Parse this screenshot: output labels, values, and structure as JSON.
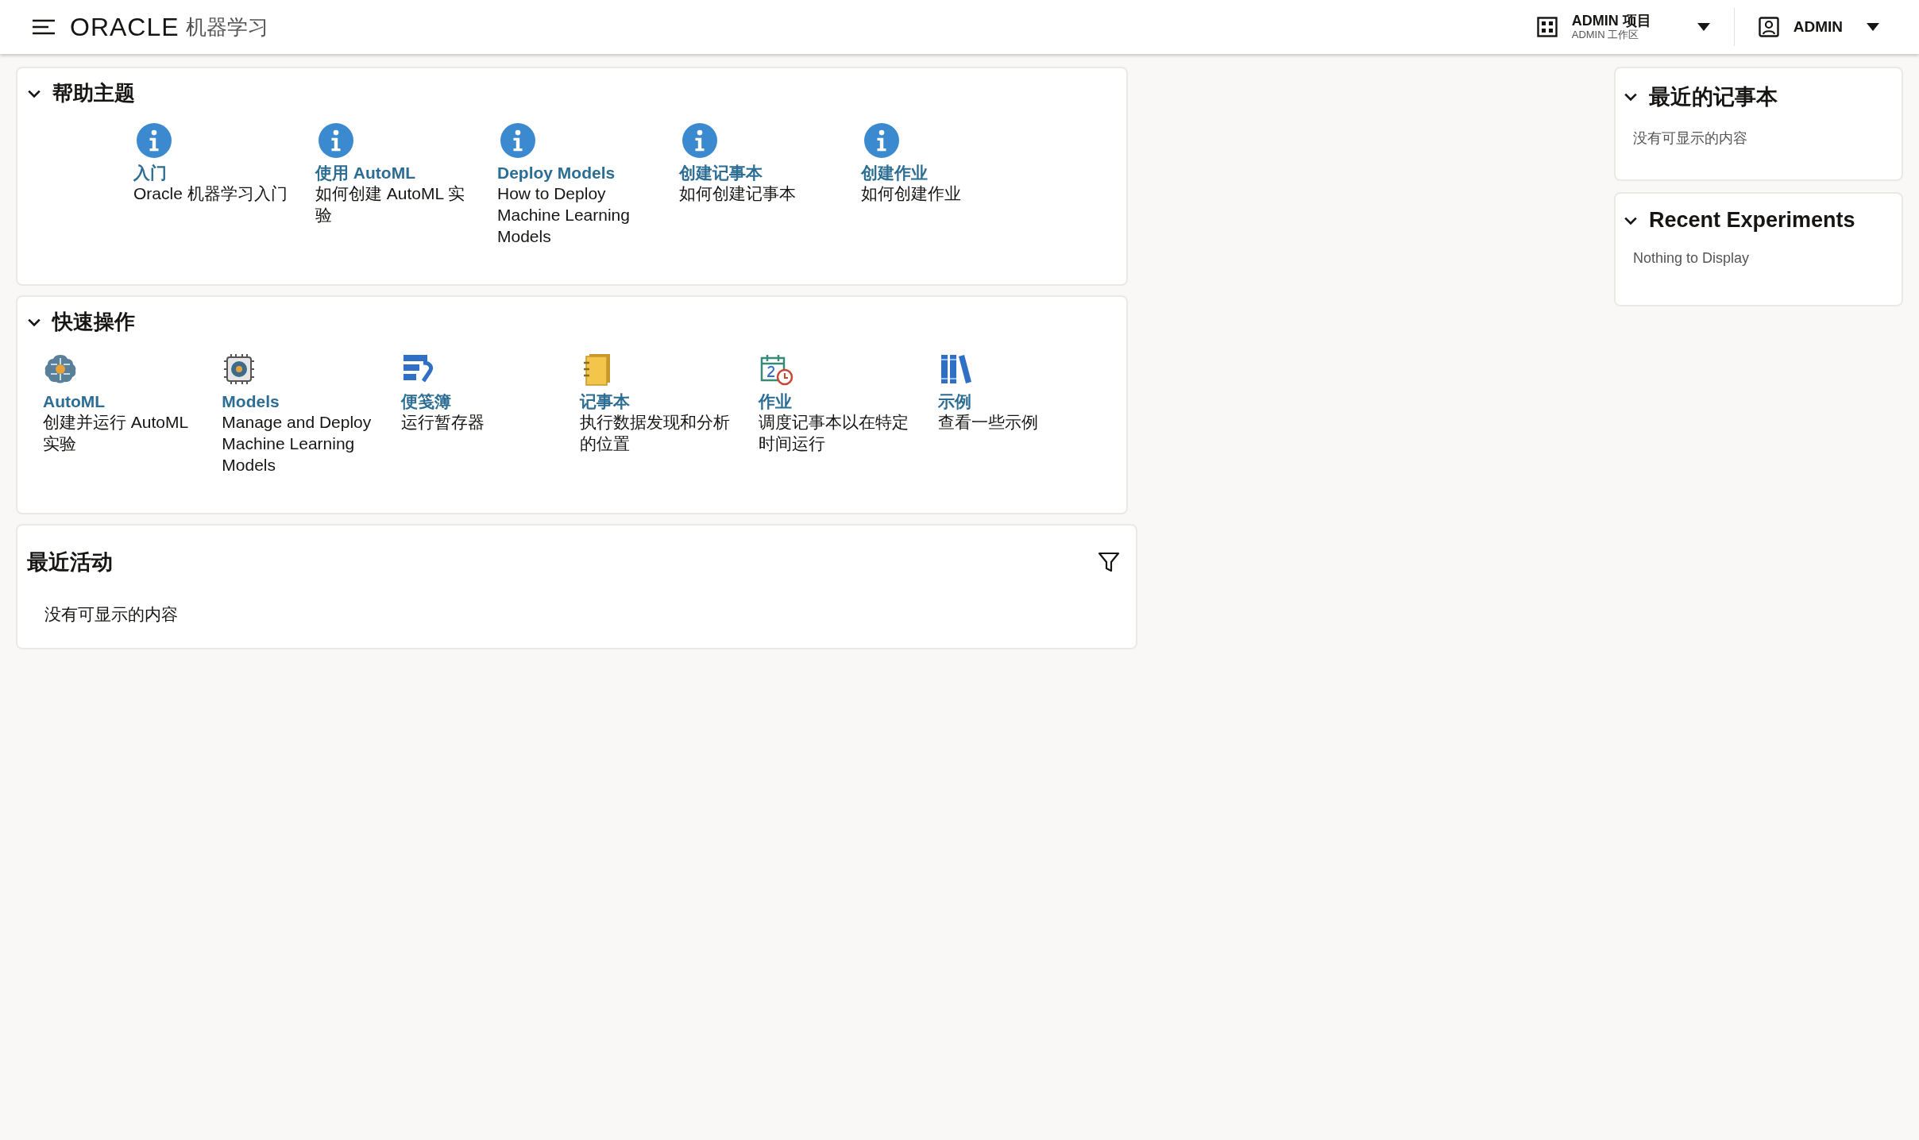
{
  "header": {
    "brand": "ORACLE",
    "product": "机器学习",
    "project": {
      "name": "ADMIN 项目",
      "workspace": "ADMIN 工作区"
    },
    "user": "ADMIN"
  },
  "help_topics": {
    "title": "帮助主题",
    "expanded": true,
    "items": [
      {
        "title": "入门",
        "description": "Oracle 机器学习入门"
      },
      {
        "title": "使用 AutoML",
        "description": "如何创建 AutoML 实验"
      },
      {
        "title": "Deploy Models",
        "description": "How to Deploy Machine Learning Models"
      },
      {
        "title": "创建记事本",
        "description": "如何创建记事本"
      },
      {
        "title": "创建作业",
        "description": "如何创建作业"
      }
    ]
  },
  "quick_actions": {
    "title": "快速操作",
    "expanded": true,
    "items": [
      {
        "kind": "brain",
        "title": "AutoML",
        "description": "创建并运行 AutoML 实验"
      },
      {
        "kind": "chip",
        "title": "Models",
        "description": "Manage and Deploy Machine Learning Models"
      },
      {
        "kind": "scratchpad",
        "title": "便笺簿",
        "description": "运行暂存器"
      },
      {
        "kind": "notebook",
        "title": "记事本",
        "description": "执行数据发现和分析的位置"
      },
      {
        "kind": "schedule",
        "title": "作业",
        "description": "调度记事本以在特定时间运行"
      },
      {
        "kind": "books",
        "title": "示例",
        "description": "查看一些示例"
      }
    ]
  },
  "recent_activity": {
    "title": "最近活动",
    "empty_text": "没有可显示的内容"
  },
  "side_panels": [
    {
      "title": "最近的记事本",
      "expanded": true,
      "empty_text": "没有可显示的内容"
    },
    {
      "title": "Recent Experiments",
      "expanded": true,
      "empty_text": "Nothing to Display"
    }
  ]
}
